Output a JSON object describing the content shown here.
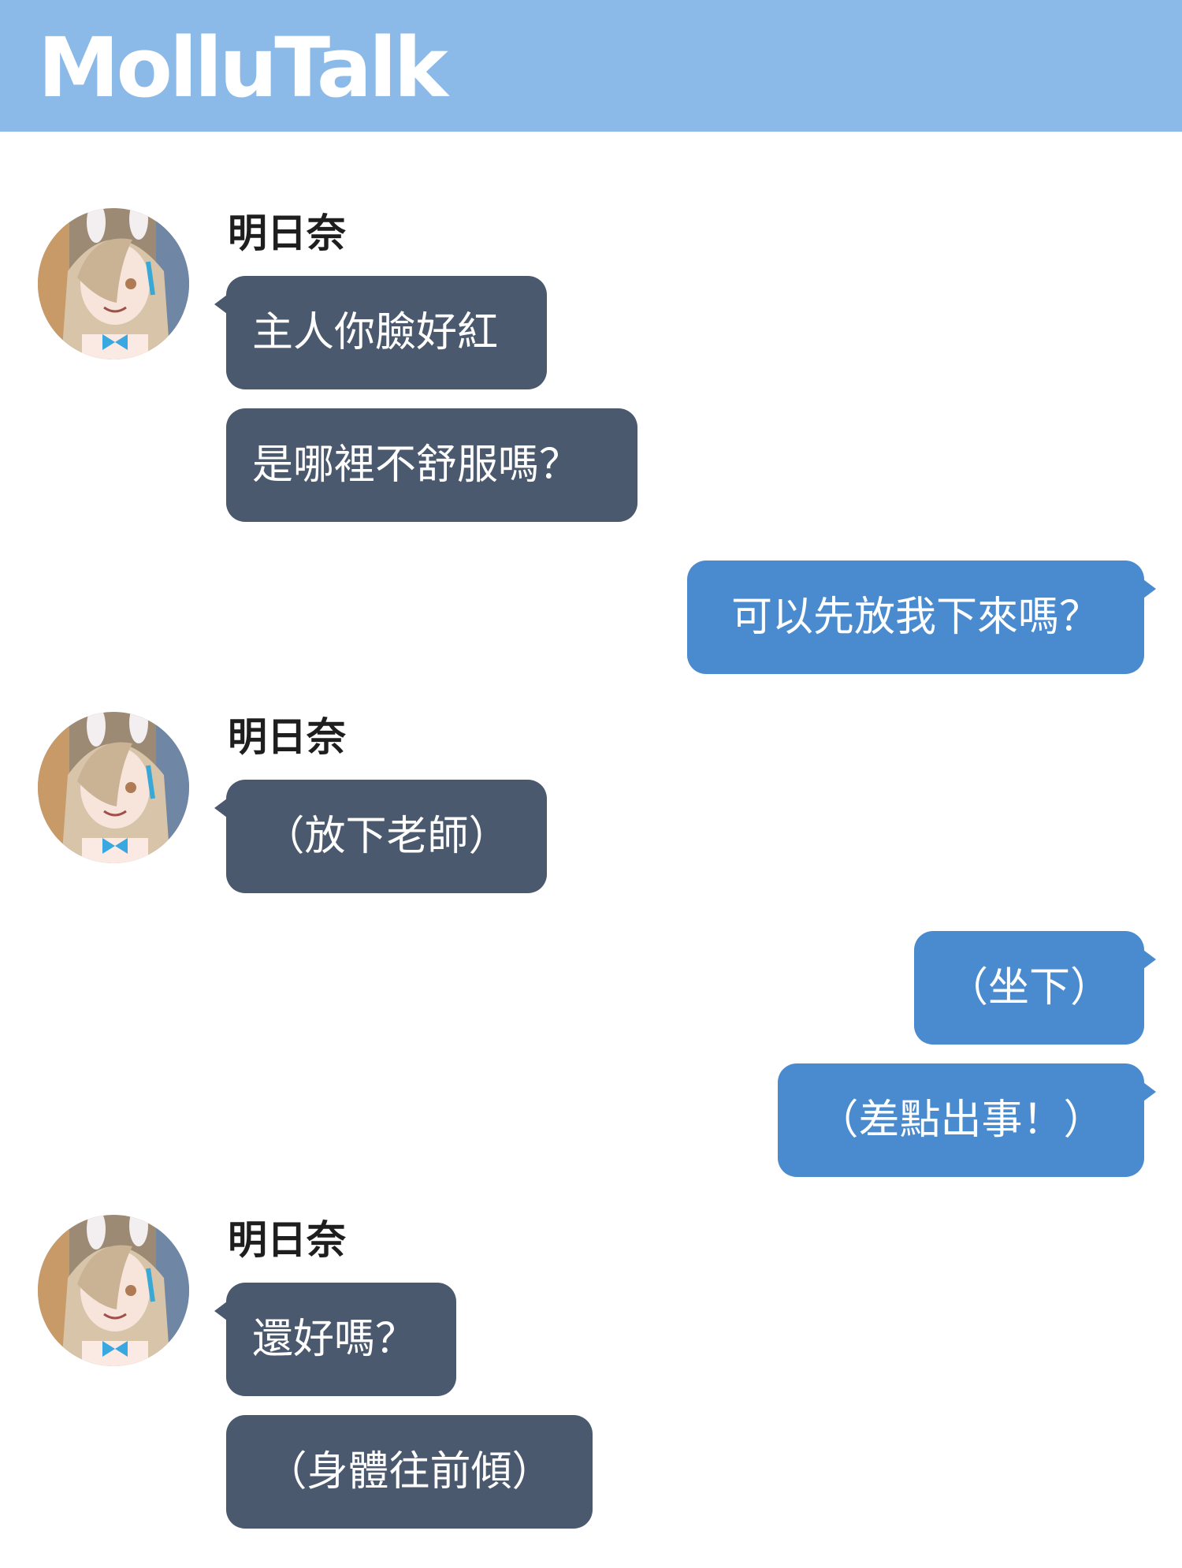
{
  "app": {
    "title": "MolluTalk"
  },
  "colors": {
    "header_bg": "#8bbae9",
    "incoming_bubble": "#4b596e",
    "outgoing_bubble": "#4a8ace",
    "name_text": "#1e1e1e"
  },
  "messages": {
    "group1": {
      "sender": "明日奈",
      "avatar_icon": "character-avatar-icon",
      "lines": [
        "主人你臉好紅",
        "是哪裡不舒服嗎？"
      ]
    },
    "reply1": {
      "lines": [
        "可以先放我下來嗎？"
      ]
    },
    "group2": {
      "sender": "明日奈",
      "avatar_icon": "character-avatar-icon",
      "lines": [
        "（放下老師）"
      ]
    },
    "reply2": {
      "lines": [
        "（坐下）",
        "（差點出事！）"
      ]
    },
    "group3": {
      "sender": "明日奈",
      "avatar_icon": "character-avatar-icon",
      "lines": [
        "還好嗎？",
        "（身體往前傾）"
      ]
    }
  }
}
